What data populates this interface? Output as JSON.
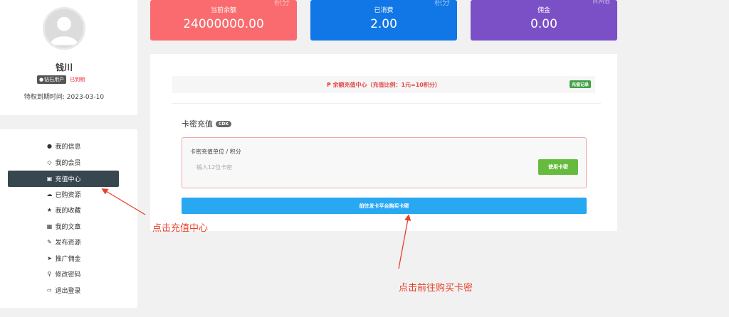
{
  "profile": {
    "username": "钱川",
    "vip_badge": "钻石用户",
    "expired_label": "已到期",
    "expire_text": "特权到期时间:  2023-03-10"
  },
  "menu": [
    {
      "label": "我的信息",
      "icon": "user-icon"
    },
    {
      "label": "我的会员",
      "icon": "diamond-icon"
    },
    {
      "label": "充值中心",
      "icon": "credit-card-icon",
      "active": true
    },
    {
      "label": "已购资源",
      "icon": "cloud-download-icon"
    },
    {
      "label": "我的收藏",
      "icon": "star-icon"
    },
    {
      "label": "我的文章",
      "icon": "file-icon"
    },
    {
      "label": "发布资源",
      "icon": "pencil-icon"
    },
    {
      "label": "推广佣金",
      "icon": "paper-plane-icon"
    },
    {
      "label": "修改密码",
      "icon": "key-icon"
    },
    {
      "label": "退出登录",
      "icon": "sign-out-icon"
    }
  ],
  "stats": {
    "balance": {
      "label": "当前余额",
      "value": "24000000.00",
      "unit": "积分",
      "color": "#f96b6e"
    },
    "spent": {
      "label": "已消费",
      "value": "2.00",
      "unit": "积分",
      "color": "#1176e6"
    },
    "commission": {
      "label": "佣金",
      "value": "0.00",
      "unit": "RMB",
      "color": "#7b50c6"
    }
  },
  "recharge": {
    "notice": "余额充值中心（充值比例：1元=10积分）",
    "record_button": "充值记录",
    "section_title": "卡密充值",
    "cdk_tag": "CDK",
    "unit_label": "卡密充值单位 / 积分",
    "card_input_placeholder": "输入12位卡密",
    "use_button": "使用卡密",
    "buy_button": "前往发卡平台购买卡密"
  },
  "annotations": {
    "left": "点击充值中心",
    "bottom": "点击前往购买卡密",
    "color": "#e8402a"
  }
}
